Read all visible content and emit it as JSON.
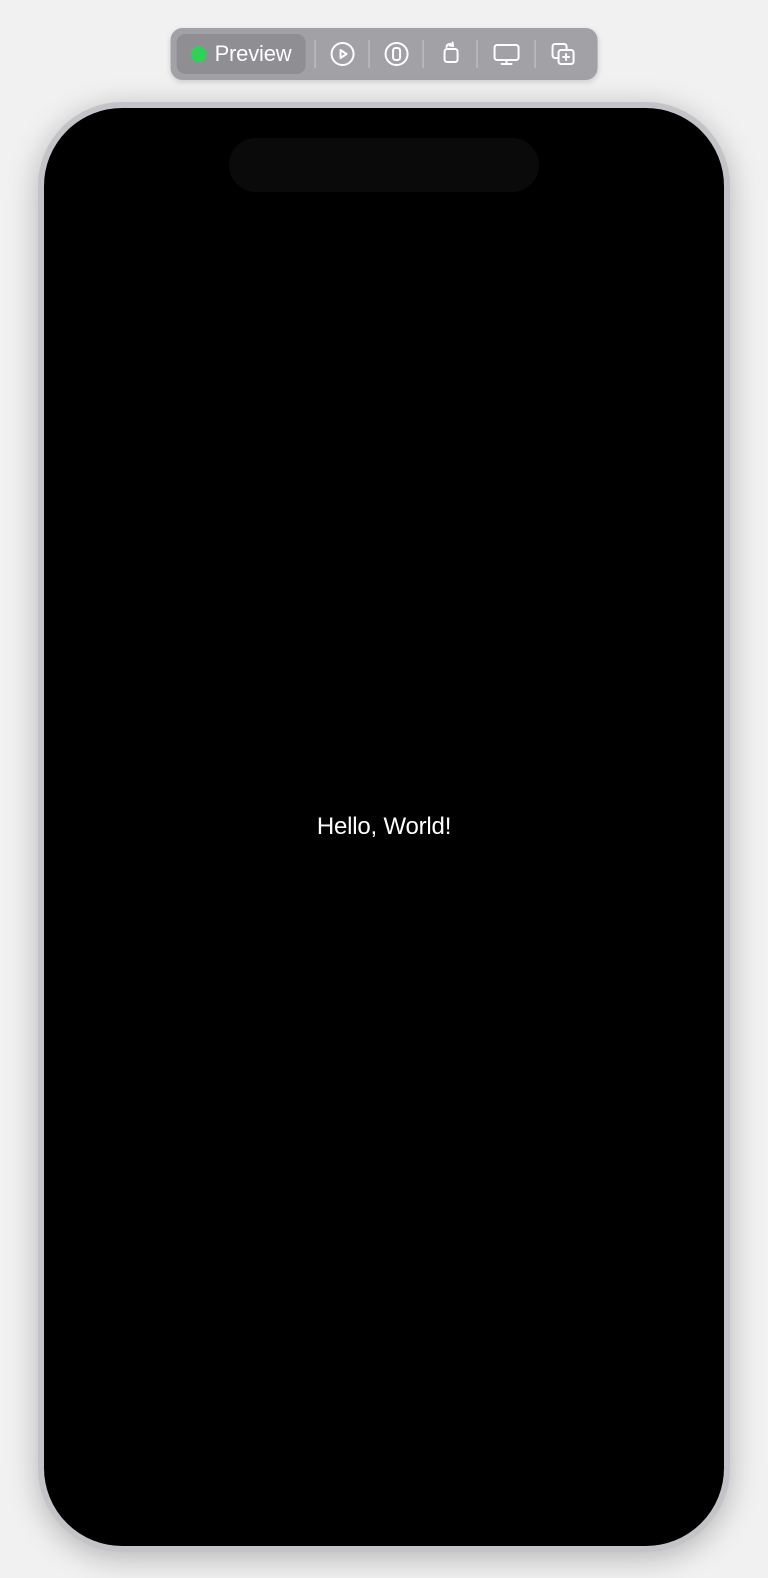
{
  "toolbar": {
    "preview_label": "Preview",
    "status_color": "#30d158",
    "icons": {
      "run": "run-icon",
      "variants": "variants-icon",
      "rotate": "rotate-icon",
      "device": "device-icon",
      "duplicate": "duplicate-icon"
    }
  },
  "preview": {
    "body_text": "Hello, World!"
  }
}
